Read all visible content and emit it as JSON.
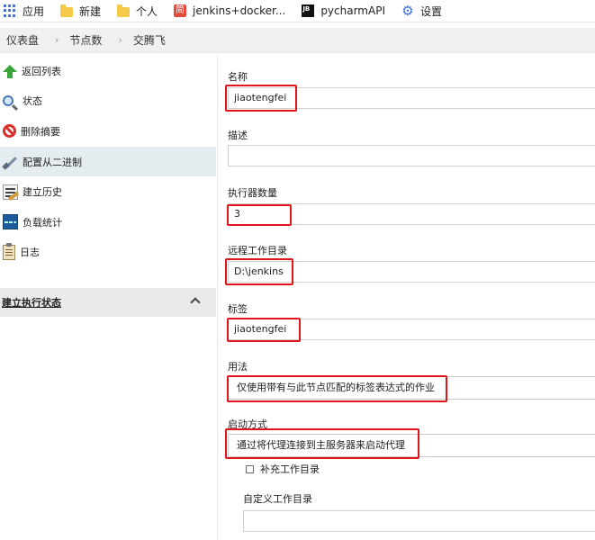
{
  "bookmarks": [
    {
      "label": "应用",
      "icon": "apps-grid-icon",
      "kind": "apps"
    },
    {
      "label": "新建",
      "icon": "folder-icon",
      "kind": "folder"
    },
    {
      "label": "个人",
      "icon": "folder-icon",
      "kind": "folder"
    },
    {
      "label": "jenkins+docker...",
      "icon": "jenkins-favicon-icon",
      "kind": "jenkins",
      "glyph": "简"
    },
    {
      "label": "pycharmAPI",
      "icon": "jetbrains-icon",
      "kind": "jb",
      "glyph": "JB"
    },
    {
      "label": "设置",
      "icon": "gear-icon",
      "kind": "settings",
      "glyph": "⚙"
    }
  ],
  "breadcrumb": [
    "仪表盘",
    "节点数",
    "交腾飞"
  ],
  "breadcrumb_separator": "›",
  "sidebar": {
    "items": [
      {
        "label": "返回列表",
        "icon": "up-arrow-icon",
        "active": false
      },
      {
        "label": "状态",
        "icon": "search-icon",
        "active": false
      },
      {
        "label": "删除摘要",
        "icon": "delete-icon",
        "active": false
      },
      {
        "label": "配置从二进制",
        "icon": "tools-icon",
        "active": true
      },
      {
        "label": "建立历史",
        "icon": "history-icon",
        "active": false
      },
      {
        "label": "负载统计",
        "icon": "load-stats-icon",
        "active": false
      },
      {
        "label": "日志",
        "icon": "log-icon",
        "active": false
      }
    ],
    "executor_section": {
      "title": "建立执行状态",
      "icon": "chevron-up-icon"
    }
  },
  "form": {
    "name_label": "名称",
    "name_value": "jiaotengfei",
    "description_label": "描述",
    "description_value": "",
    "executors_label": "执行器数量",
    "executors_value": "3",
    "remote_dir_label": "远程工作目录",
    "remote_dir_value": "D:\\jenkins",
    "labels_label": "标签",
    "labels_value": "jiaotengfei",
    "usage_label": "用法",
    "usage_value": "仅使用带有与此节点匹配的标签表达式的作业",
    "launch_label": "启动方式",
    "launch_value": "通过将代理连接到主服务器来启动代理",
    "workdir_checkbox_label": "补充工作目录",
    "workdir_checkbox_checked": false,
    "custom_workdir_label": "自定义工作目录",
    "custom_workdir_value": ""
  },
  "colors": {
    "highlight": "#e0141b",
    "sidebar_active": "#e5ecf0",
    "breadcrumb_bg": "#f0f0f0"
  }
}
